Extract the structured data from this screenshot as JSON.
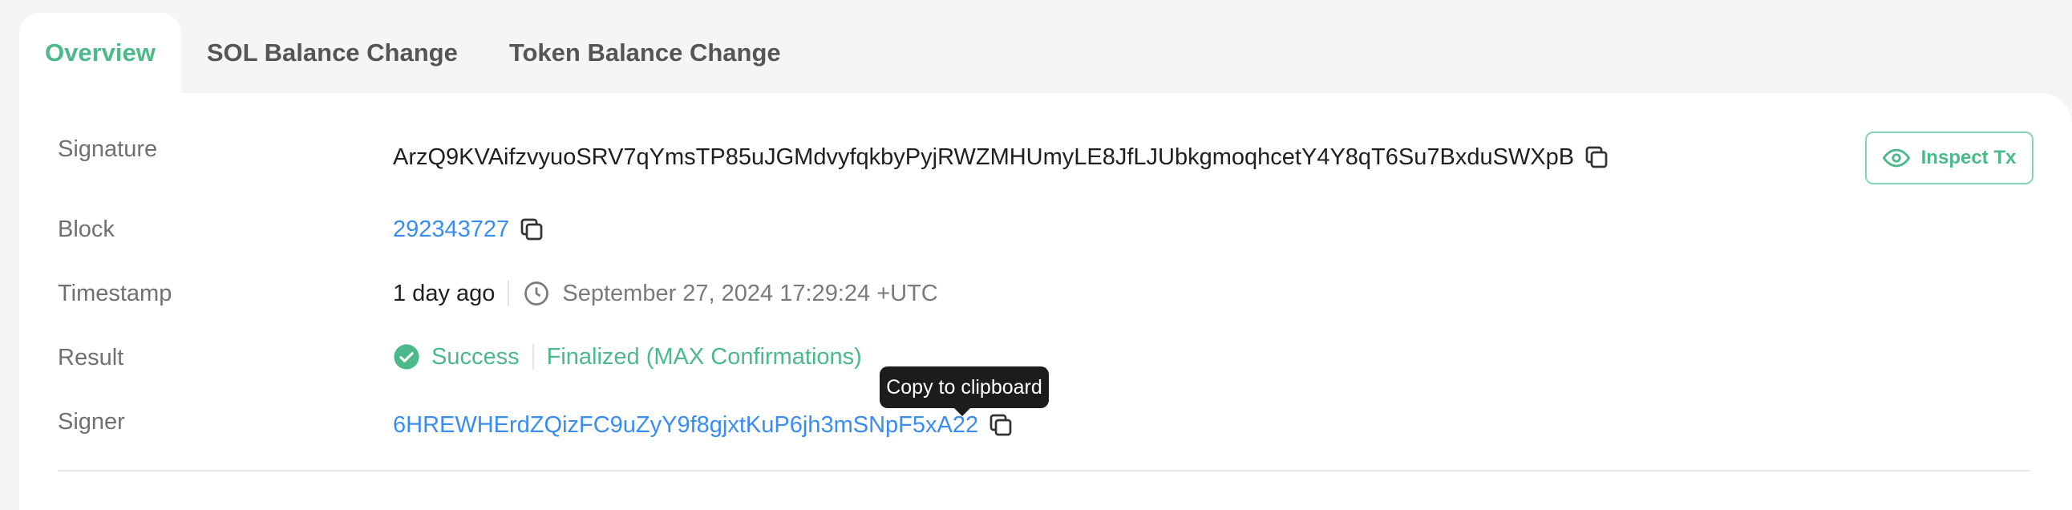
{
  "tabs": [
    {
      "label": "Overview",
      "active": true
    },
    {
      "label": "SOL Balance Change",
      "active": false
    },
    {
      "label": "Token Balance Change",
      "active": false
    }
  ],
  "details": {
    "signature": {
      "label": "Signature",
      "value": "ArzQ9KVAifzvyuoSRV7qYmsTP85uJGMdvyfqkbyPyjRWZMHUmyLE8JfLJUbkgmoqhcetY4Y8qT6Su7BxduSWXpB"
    },
    "block": {
      "label": "Block",
      "value": "292343727"
    },
    "timestamp": {
      "label": "Timestamp",
      "relative": "1 day ago",
      "absolute": "September 27, 2024 17:29:24 +UTC"
    },
    "result": {
      "label": "Result",
      "status": "Success",
      "confirmation": "Finalized (MAX Confirmations)"
    },
    "signer": {
      "label": "Signer",
      "value": "6HREWHErdZQizFC9uZyY9f8gjxtKuP6jh3mSNpF5xA22"
    }
  },
  "inspect_button": {
    "label": "Inspect Tx"
  },
  "tooltip": {
    "text": "Copy to clipboard"
  },
  "colors": {
    "accent": "#4bb98a",
    "link": "#3a8df0",
    "label": "#707070"
  },
  "icons": [
    "copy-icon",
    "clock-icon",
    "check-circle-icon",
    "eye-icon"
  ]
}
